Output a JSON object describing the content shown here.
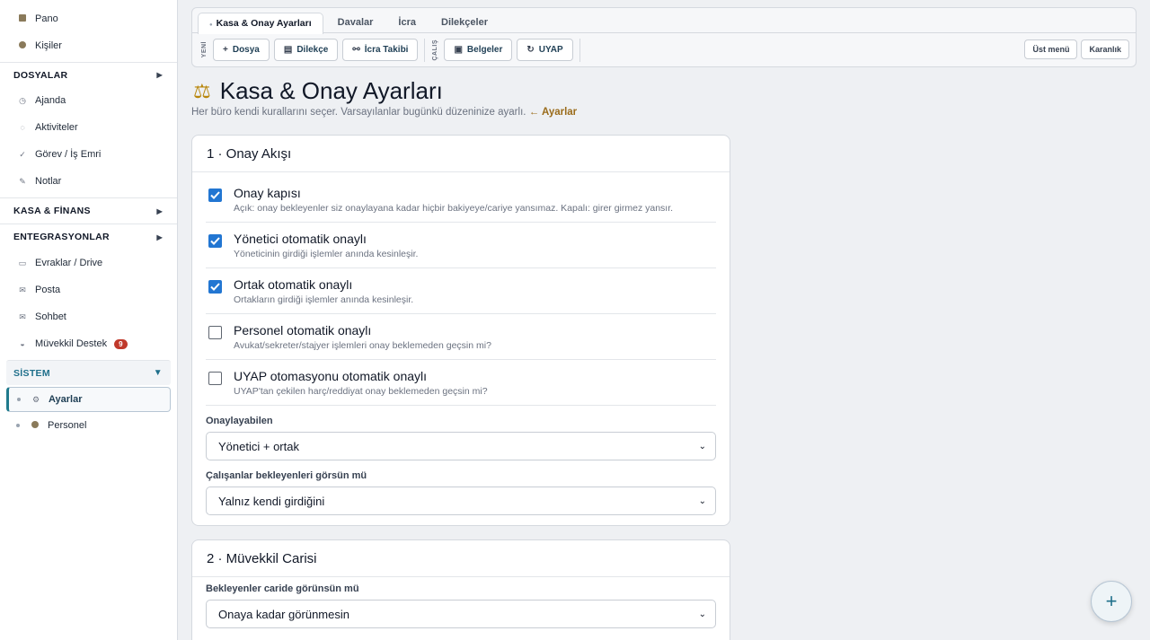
{
  "sidebar": {
    "top_items": [
      {
        "label": "Pano",
        "icon": "dashboard-icon"
      },
      {
        "label": "Kişiler",
        "icon": "people-icon"
      }
    ],
    "sections": {
      "dosyalar": "DOSYALAR",
      "kasa": "KASA & FİNANS",
      "entegrasyonlar": "ENTEGRASYONLAR",
      "sistem": "SİSTEM"
    },
    "dosyalar_items": [
      {
        "label": "Ajanda",
        "icon": "calendar-icon"
      },
      {
        "label": "Aktiviteler",
        "icon": "activity-icon"
      },
      {
        "label": "Görev / İş Emri",
        "icon": "check-icon"
      },
      {
        "label": "Notlar",
        "icon": "pencil-icon"
      }
    ],
    "entegrasyon_items": [
      {
        "label": "Evraklar / Drive",
        "icon": "folder-icon"
      },
      {
        "label": "Posta",
        "icon": "mail-icon"
      },
      {
        "label": "Sohbet",
        "icon": "chat-icon"
      },
      {
        "label": "Müvekkil Destek",
        "icon": "support-icon",
        "badge": "9"
      }
    ],
    "sistem_items": [
      {
        "label": "Ayarlar",
        "icon": "gear-icon"
      },
      {
        "label": "Personel",
        "icon": "person-icon"
      }
    ]
  },
  "topbar": {
    "tabs": [
      "Kasa & Onay Ayarları",
      "Davalar",
      "İcra",
      "Dilekçeler"
    ],
    "group1_label": "YENİ",
    "group2_label": "ÇALIŞ",
    "buttons1": [
      "Dosya",
      "Dilekçe",
      "İcra Takibi"
    ],
    "buttons2": [
      "Belgeler",
      "UYAP"
    ],
    "right_buttons": [
      "Üst menü",
      "Karanlık"
    ]
  },
  "page": {
    "title": "Kasa & Onay Ayarları",
    "subtitle": "Her büro kendi kurallarını seçer. Varsayılanlar bugünkü düzeninize ayarlı.",
    "back_link": "← Ayarlar"
  },
  "section1": {
    "title": "1 · Onay Akışı",
    "options": [
      {
        "title": "Onay kapısı",
        "desc": "Açık: onay bekleyenler siz onaylayana kadar hiçbir bakiyeye/cariye yansımaz. Kapalı: girer girmez yansır.",
        "checked": true
      },
      {
        "title": "Yönetici otomatik onaylı",
        "desc": "Yöneticinin girdiği işlemler anında kesinleşir.",
        "checked": true
      },
      {
        "title": "Ortak otomatik onaylı",
        "desc": "Ortakların girdiği işlemler anında kesinleşir.",
        "checked": true
      },
      {
        "title": "Personel otomatik onaylı",
        "desc": "Avukat/sekreter/stajyer işlemleri onay beklemeden geçsin mi?",
        "checked": false
      },
      {
        "title": "UYAP otomasyonu otomatik onaylı",
        "desc": "UYAP'tan çekilen harç/reddiyat onay beklemeden geçsin mi?",
        "checked": false
      }
    ],
    "approver_label": "Onaylayabilen",
    "approver_value": "Yönetici + ortak",
    "visibility_label": "Çalışanlar bekleyenleri görsün mü",
    "visibility_value": "Yalnız kendi girdiğini"
  },
  "section2": {
    "title": "2 · Müvekkil Carisi",
    "field_label": "Bekleyenler caride görünsün mü",
    "field_value": "Onaya kadar görünmesin"
  },
  "fab_label": "+"
}
